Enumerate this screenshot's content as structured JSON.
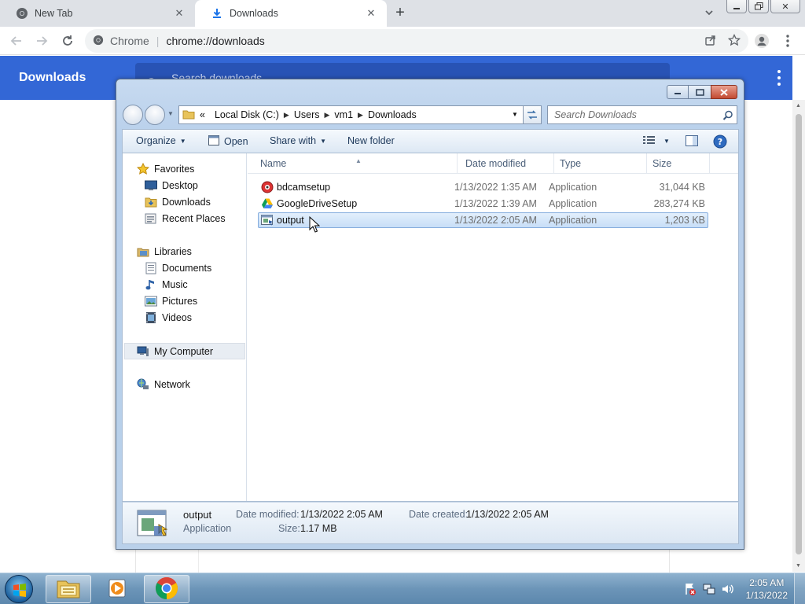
{
  "browser": {
    "tabs": [
      {
        "title": "New Tab",
        "icon": "chrome-icon",
        "active": false
      },
      {
        "title": "Downloads",
        "icon": "download-icon",
        "active": true
      }
    ],
    "omnibox": {
      "site_label": "Chrome",
      "url": "chrome://downloads"
    }
  },
  "downloads_page": {
    "title": "Downloads",
    "search_placeholder": "Search downloads"
  },
  "explorer": {
    "address": {
      "prefix": "«",
      "crumbs": [
        "Local Disk (C:)",
        "Users",
        "vm1",
        "Downloads"
      ]
    },
    "search_placeholder": "Search Downloads",
    "commands": {
      "organize": "Organize",
      "open": "Open",
      "share_with": "Share with",
      "new_folder": "New folder"
    },
    "nav": {
      "favorites": "Favorites",
      "desktop": "Desktop",
      "downloads": "Downloads",
      "recent_places": "Recent Places",
      "libraries": "Libraries",
      "documents": "Documents",
      "music": "Music",
      "pictures": "Pictures",
      "videos": "Videos",
      "my_computer": "My Computer",
      "network": "Network"
    },
    "columns": {
      "name": "Name",
      "date": "Date modified",
      "type": "Type",
      "size": "Size"
    },
    "files": [
      {
        "name": "bdcamsetup",
        "date": "1/13/2022 1:35 AM",
        "type": "Application",
        "size": "31,044 KB"
      },
      {
        "name": "GoogleDriveSetup",
        "date": "1/13/2022 1:39 AM",
        "type": "Application",
        "size": "283,274 KB"
      },
      {
        "name": "output",
        "date": "1/13/2022 2:05 AM",
        "type": "Application",
        "size": "1,203 KB",
        "selected": true
      }
    ],
    "details": {
      "name": "output",
      "kind": "Application",
      "date_modified_label": "Date modified:",
      "date_modified": "1/13/2022 2:05 AM",
      "date_created_label": "Date created:",
      "date_created": "1/13/2022 2:05 AM",
      "size_label": "Size:",
      "size": "1.17 MB"
    }
  },
  "taskbar": {
    "time": "2:05 AM",
    "date": "1/13/2022"
  },
  "colors": {
    "chrome_accent": "#3367d6",
    "selection": "#c7def7",
    "taskbar": "#6c95b8"
  }
}
